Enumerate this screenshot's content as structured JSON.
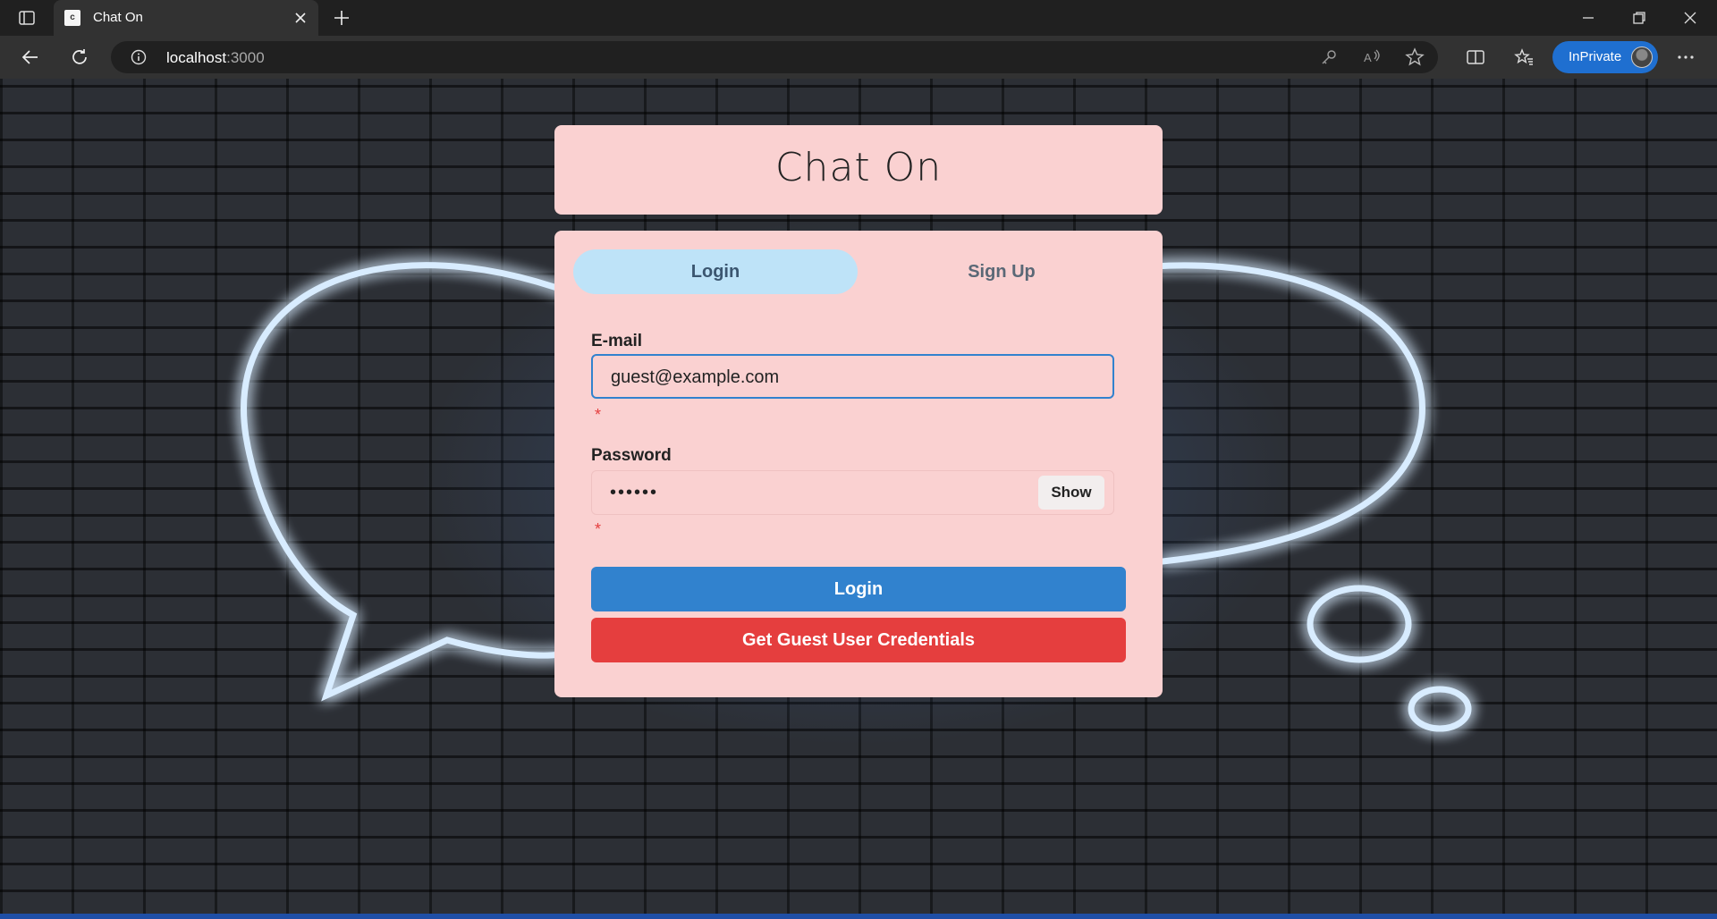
{
  "browser": {
    "tab_title": "Chat On",
    "tab_favicon_letter": "c",
    "url_host": "localhost",
    "url_port": ":3000",
    "inprivate_label": "InPrivate"
  },
  "app": {
    "title": "Chat On",
    "tabs": [
      {
        "label": "Login",
        "active": true
      },
      {
        "label": "Sign Up",
        "active": false
      }
    ],
    "email": {
      "label": "E-mail",
      "value": "guest@example.com",
      "required_mark": "*"
    },
    "password": {
      "label": "Password",
      "value": "••••••",
      "required_mark": "*",
      "toggle_label": "Show"
    },
    "login_button": "Login",
    "guest_button": "Get Guest User Credentials"
  },
  "colors": {
    "card_bg": "#fad1d1",
    "active_tab": "#bee3f8",
    "primary": "#3182ce",
    "danger": "#e53e3e",
    "inprivate": "#1f6fd0"
  }
}
